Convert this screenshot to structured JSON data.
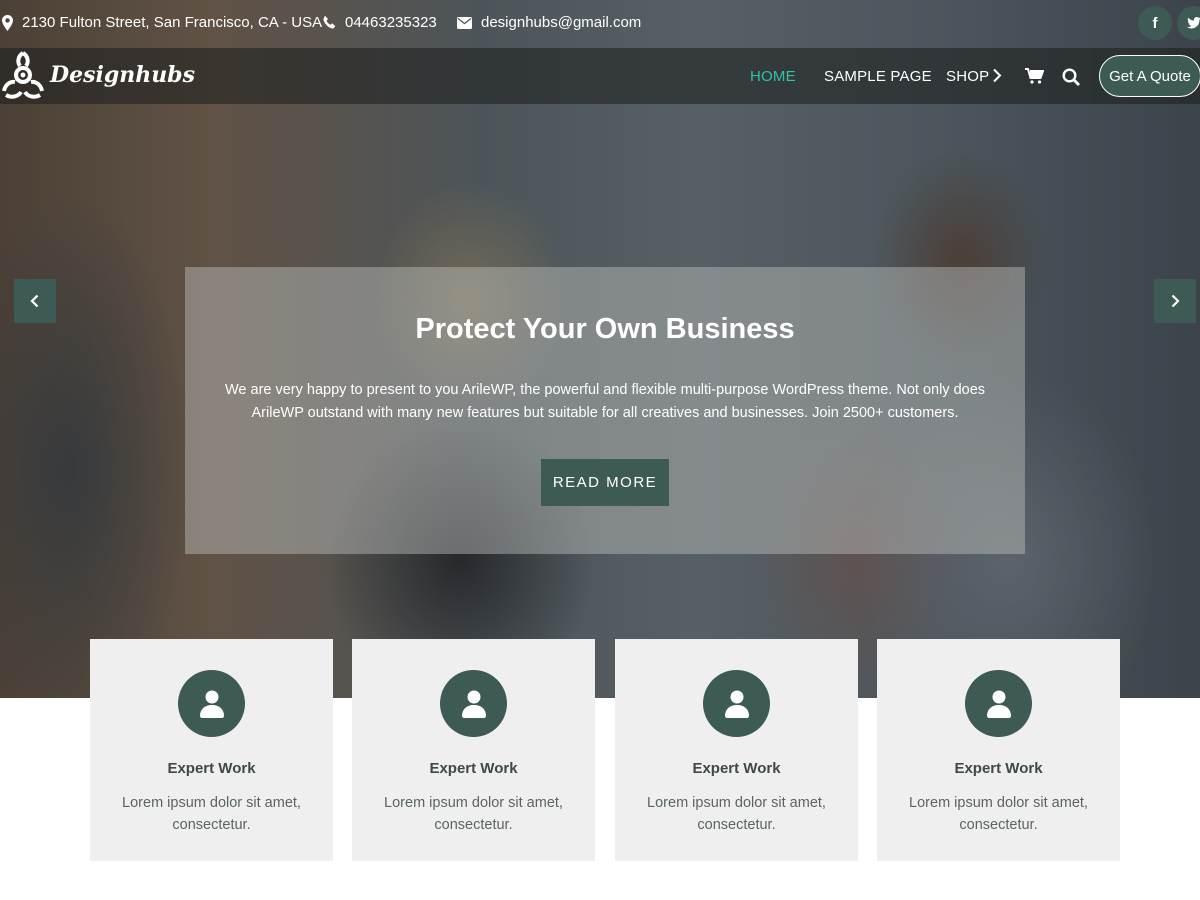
{
  "topbar": {
    "address": "2130 Fulton Street, San Francisco, CA - USA",
    "phone": "04463235323",
    "email": "designhubs@gmail.com",
    "social": [
      "f",
      "t"
    ]
  },
  "brand": {
    "name": "Designhubs"
  },
  "nav": {
    "items": [
      {
        "label": "HOME",
        "active": true
      },
      {
        "label": "SAMPLE PAGE",
        "active": false
      },
      {
        "label": "SHOP",
        "active": false
      }
    ],
    "cta_label": "Get A Quote"
  },
  "slider": {
    "title": "Protect Your Own Business",
    "text": "We are very happy to present to you ArileWP, the powerful and flexible multi-purpose WordPress theme. Not only does ArileWP outstand with many new features but suitable for all creatives and businesses. Join 2500+ customers.",
    "button_label": "READ MORE"
  },
  "features": [
    {
      "title": "Expert Work",
      "text": "Lorem ipsum dolor sit amet, consectetur."
    },
    {
      "title": "Expert Work",
      "text": "Lorem ipsum dolor sit amet, consectetur."
    },
    {
      "title": "Expert Work",
      "text": "Lorem ipsum dolor sit amet, consectetur."
    },
    {
      "title": "Expert Work",
      "text": "Lorem ipsum dolor sit amet, consectetur."
    }
  ],
  "colors": {
    "accent": "#3e5a55",
    "nav_active": "#2ec4a4",
    "card_bg": "#efefef"
  },
  "icons": {
    "address": "map-marker-icon",
    "phone": "phone-icon",
    "email": "envelope-icon",
    "facebook": "facebook-icon",
    "twitter": "twitter-icon",
    "cart": "cart-icon",
    "search": "search-icon",
    "submenu": "chevron-right-icon",
    "slider_prev": "chevron-left-icon",
    "slider_next": "chevron-right-icon",
    "feature": "user-icon"
  }
}
